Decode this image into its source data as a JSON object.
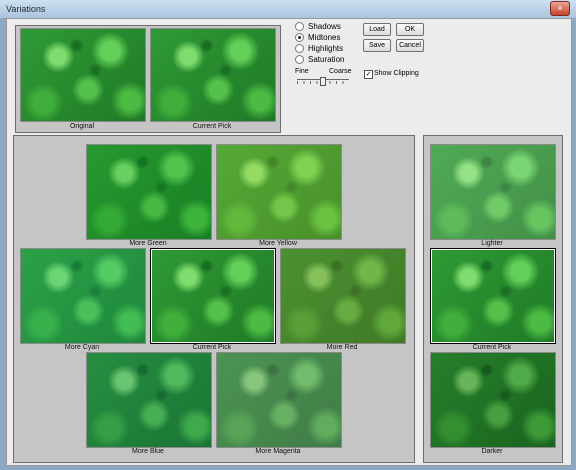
{
  "window": {
    "title": "Variations",
    "close_glyph": "×"
  },
  "top_panel": {
    "original_label": "Original",
    "current_pick_label": "Current Pick"
  },
  "options": {
    "radios": [
      {
        "label": "Shadows",
        "selected": false
      },
      {
        "label": "Midtones",
        "selected": true
      },
      {
        "label": "Highlights",
        "selected": false
      },
      {
        "label": "Saturation",
        "selected": false
      }
    ],
    "fine_label": "Fine",
    "coarse_label": "Coarse",
    "show_clipping_label": "Show Clipping",
    "show_clipping_checked": true,
    "show_clipping_glyph": "✓"
  },
  "buttons": {
    "load": "Load",
    "ok": "OK",
    "save": "Save",
    "cancel": "Cancel"
  },
  "color_panel": {
    "more_green": "More Green",
    "more_yellow": "More Yellow",
    "more_cyan": "More Cyan",
    "current_pick": "Current Pick",
    "more_red": "More Red",
    "more_blue": "More Blue",
    "more_magenta": "More Magenta"
  },
  "brightness_panel": {
    "lighter": "Lighter",
    "current_pick": "Current Pick",
    "darker": "Darker"
  },
  "colors": {
    "panel_bg": "#c5c5c5",
    "dialog_bg": "#ececec",
    "clover_base": "#2f9a35"
  }
}
